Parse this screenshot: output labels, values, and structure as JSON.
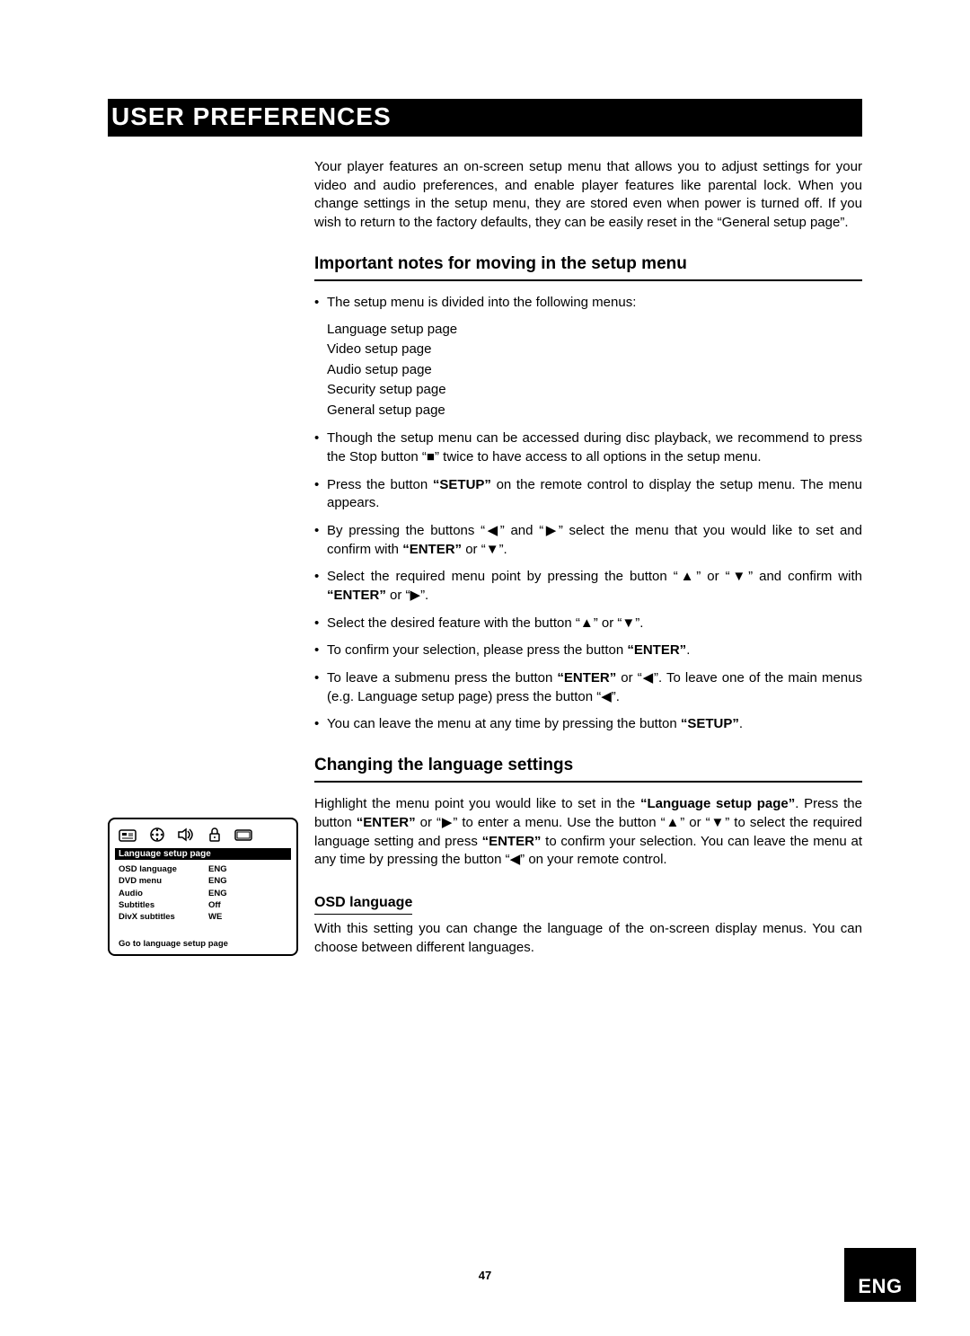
{
  "title": "USER PREFERENCES",
  "intro": "Your player features an on-screen setup menu that allows you to adjust settings for your video and audio preferences, and enable player features like parental lock. When you change settings in the setup menu, they are stored even when power is turned off. If you wish to return to the factory defaults, they can be easily reset in the “General setup page”.",
  "s1_heading": "Important notes for moving in the setup menu",
  "b1": "The setup menu is divided into the following menus:",
  "menus": {
    "m1": "Language setup page",
    "m2": "Video setup page",
    "m3": "Audio setup page",
    "m4": "Security setup page",
    "m5": "General setup page"
  },
  "b2_a": "Though the setup menu can be accessed during disc playback, we recommend to press the Stop button “",
  "b2_stop": "■",
  "b2_b": "” twice to have access to all options in the setup menu.",
  "b3_a": "Press the button ",
  "b3_setup": "“SETUP”",
  "b3_b": " on the remote control to display the setup menu. The menu appears.",
  "b4_a": "By pressing the buttons “",
  "b4_l": "◀",
  "b4_b": "” and “",
  "b4_r": "▶",
  "b4_c": "” select the menu that you would like to set and confirm with ",
  "b4_enter": "“ENTER”",
  "b4_d": " or “",
  "b4_down": "▼",
  "b4_e": "”.",
  "b5_a": "Select the required menu point by pressing the button “",
  "b5_up": "▲",
  "b5_b": "” or “",
  "b5_down": "▼",
  "b5_c": "” and confirm with ",
  "b5_enter": "“ENTER”",
  "b5_d": " or “",
  "b5_r": "▶",
  "b5_e": "”.",
  "b6_a": "Select the desired feature with the button “",
  "b6_up": "▲",
  "b6_b": "” or “",
  "b6_down": "▼",
  "b6_c": "”.",
  "b7_a": "To confirm your selection, please press the button ",
  "b7_enter": "“ENTER”",
  "b7_b": ".",
  "b8_a": "To leave a submenu press the button ",
  "b8_enter": "“ENTER”",
  "b8_b": " or “",
  "b8_l": "◀",
  "b8_c": "”. To leave one of the main menus (e.g. Language setup page) press the button “",
  "b8_l2": "◀",
  "b8_d": "”.",
  "b9_a": "You can leave the menu at any time by pressing the button ",
  "b9_setup": "“SETUP”",
  "b9_b": ".",
  "s2_heading": "Changing the language settings",
  "s2_p_a": "Highlight the menu point you would like to set in the ",
  "s2_p_lsp": "“Language setup page”",
  "s2_p_b": ". Press the button ",
  "s2_p_enter": "“ENTER”",
  "s2_p_c": " or “",
  "s2_p_r": "▶",
  "s2_p_d": "” to enter a menu. Use the button “",
  "s2_p_up": "▲",
  "s2_p_e": "” or “",
  "s2_p_down": "▼",
  "s2_p_f": "” to select the required language setting and press ",
  "s2_p_enter2": "“ENTER”",
  "s2_p_g": " to confirm your selection. You can leave the menu at any time by pressing the button “",
  "s2_p_l": "◀",
  "s2_p_h": "” on your remote control.",
  "sub_h": "OSD language",
  "sub_p": "With this setting you can change the language of the on-screen display menus. You can choose between different languages.",
  "osd": {
    "title": "Language setup page",
    "items": [
      {
        "k": "OSD language",
        "v": "ENG"
      },
      {
        "k": "DVD menu",
        "v": "ENG"
      },
      {
        "k": "Audio",
        "v": "ENG"
      },
      {
        "k": "Subtitles",
        "v": "Off"
      },
      {
        "k": "DivX subtitles",
        "v": "WE"
      }
    ],
    "footer": "Go to language setup page"
  },
  "page_number": "47",
  "lang_tab": "ENG"
}
